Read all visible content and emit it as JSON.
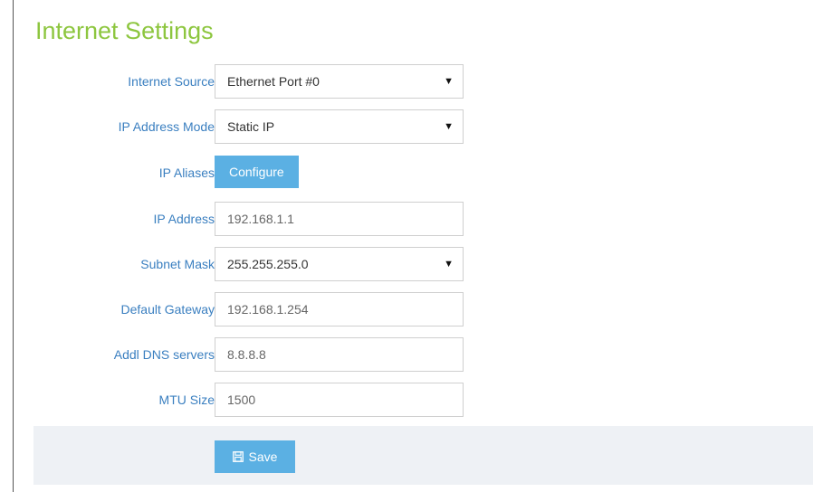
{
  "page": {
    "title": "Internet Settings"
  },
  "form": {
    "internet_source": {
      "label": "Internet Source",
      "value": "Ethernet Port #0"
    },
    "ip_address_mode": {
      "label": "IP Address Mode",
      "value": "Static IP"
    },
    "ip_aliases": {
      "label": "IP Aliases",
      "button_label": "Configure"
    },
    "ip_address": {
      "label": "IP Address",
      "value": "192.168.1.1"
    },
    "subnet_mask": {
      "label": "Subnet Mask",
      "value": "255.255.255.0"
    },
    "default_gateway": {
      "label": "Default Gateway",
      "value": "192.168.1.254"
    },
    "dns_servers": {
      "label": "Addl DNS servers",
      "value": "8.8.8.8"
    },
    "mtu_size": {
      "label": "MTU Size",
      "value": "1500"
    }
  },
  "footer": {
    "save_label": "Save",
    "save_icon": "floppy-disk-icon"
  },
  "colors": {
    "title": "#8dc63f",
    "label": "#3a7fc0",
    "button": "#5bb0e3",
    "footer_bg": "#eef1f5"
  }
}
